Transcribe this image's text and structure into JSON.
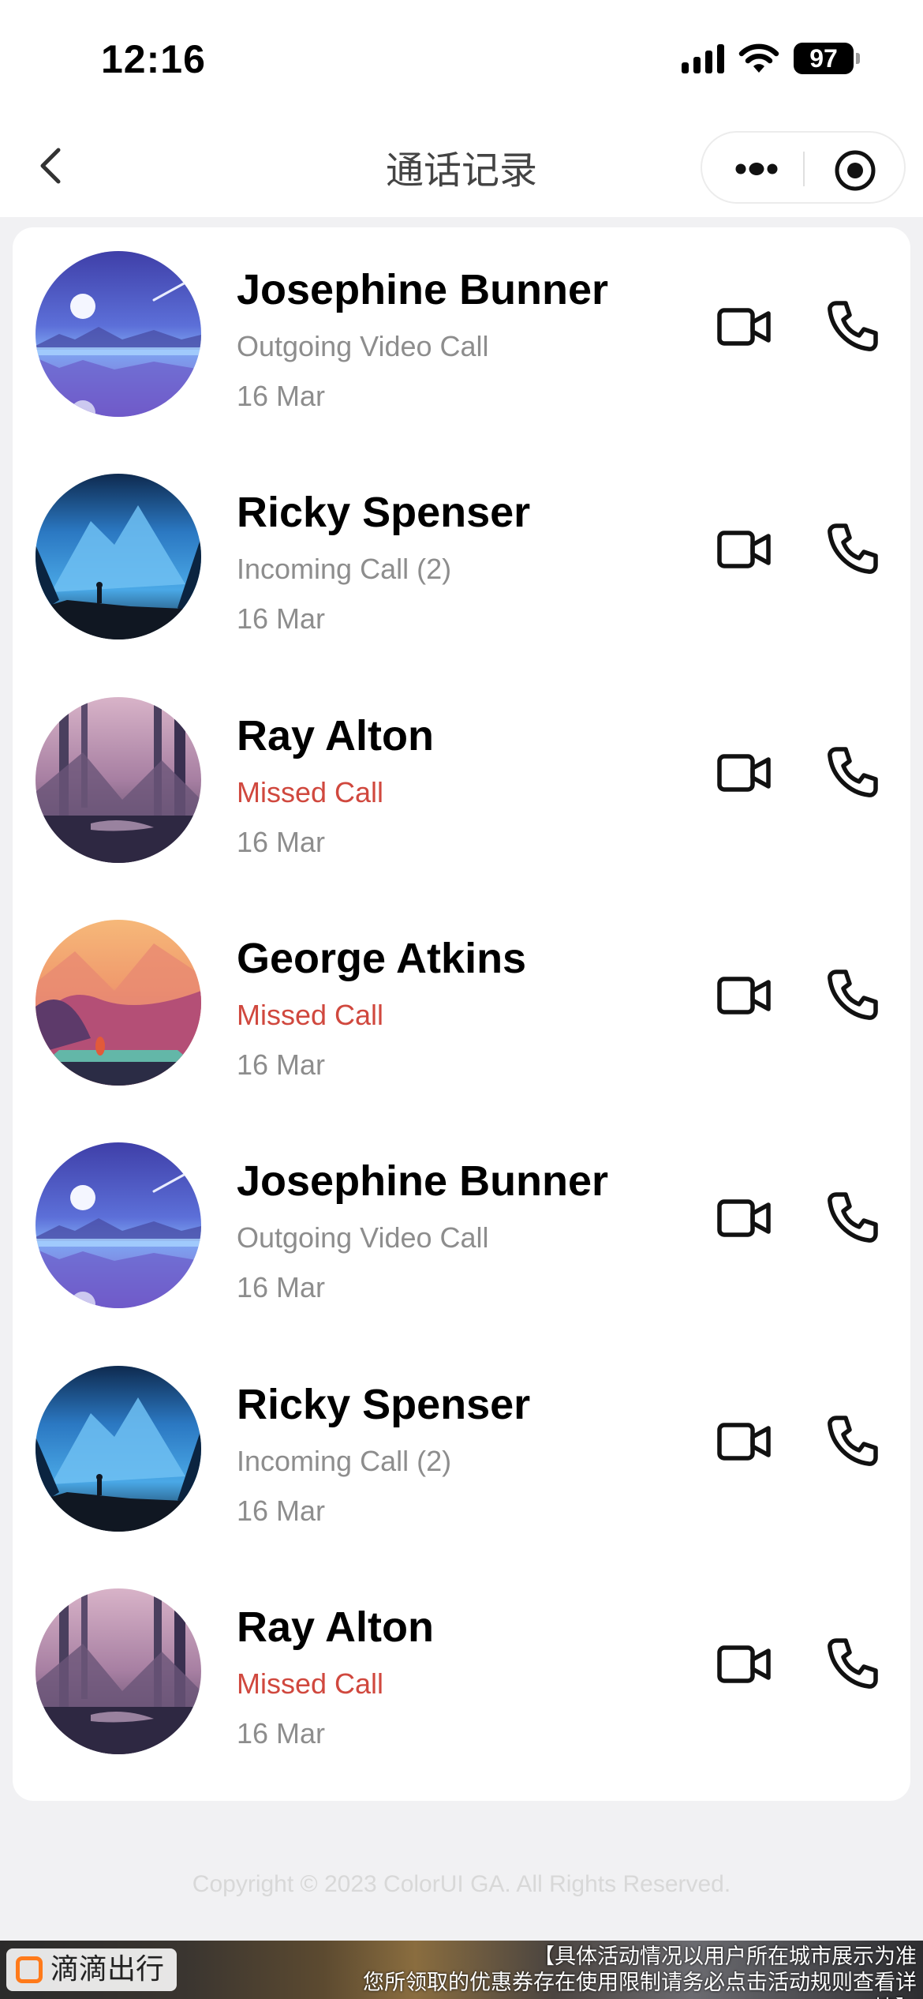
{
  "status_bar": {
    "time": "12:16",
    "battery": "97",
    "icons": [
      "signal-icon",
      "wifi-icon",
      "battery-icon"
    ]
  },
  "nav": {
    "title": "通话记录",
    "back_icon": "chevron-left-icon",
    "more_icon": "more-dots-icon",
    "close_icon": "target-circle-icon"
  },
  "calls": [
    {
      "name": "Josephine Bunner",
      "status": "Outgoing Video Call",
      "date": "16 Mar",
      "missed": false,
      "avatar": "night-sky-lake"
    },
    {
      "name": "Ricky Spenser",
      "status": "Incoming Call (2)",
      "date": "16 Mar",
      "missed": false,
      "avatar": "blue-mountain-hiker"
    },
    {
      "name": "Ray Alton",
      "status": "Missed Call",
      "date": "16 Mar",
      "missed": true,
      "avatar": "purple-forest-river"
    },
    {
      "name": "George Atkins",
      "status": "Missed Call",
      "date": "16 Mar",
      "missed": true,
      "avatar": "orange-sunset-hills"
    },
    {
      "name": "Josephine Bunner",
      "status": "Outgoing Video Call",
      "date": "16 Mar",
      "missed": false,
      "avatar": "night-sky-lake"
    },
    {
      "name": "Ricky Spenser",
      "status": "Incoming Call (2)",
      "date": "16 Mar",
      "missed": false,
      "avatar": "blue-mountain-hiker"
    },
    {
      "name": "Ray Alton",
      "status": "Missed Call",
      "date": "16 Mar",
      "missed": true,
      "avatar": "purple-forest-river"
    }
  ],
  "row_actions": {
    "video_icon": "video-camera-icon",
    "phone_icon": "phone-icon"
  },
  "footer": {
    "copyright": "Copyright © 2023 ColorUI GA. All Rights Reserved."
  },
  "banner": {
    "brand": "滴滴出行",
    "line1": "【具体活动情况以用户所在城市展示为准",
    "line2": "您所领取的优惠券存在使用限制请务必点击活动规则查看详情】"
  },
  "colors": {
    "missed": "#d0483e",
    "muted": "#8d8d8d",
    "background": "#f1f1f3"
  }
}
